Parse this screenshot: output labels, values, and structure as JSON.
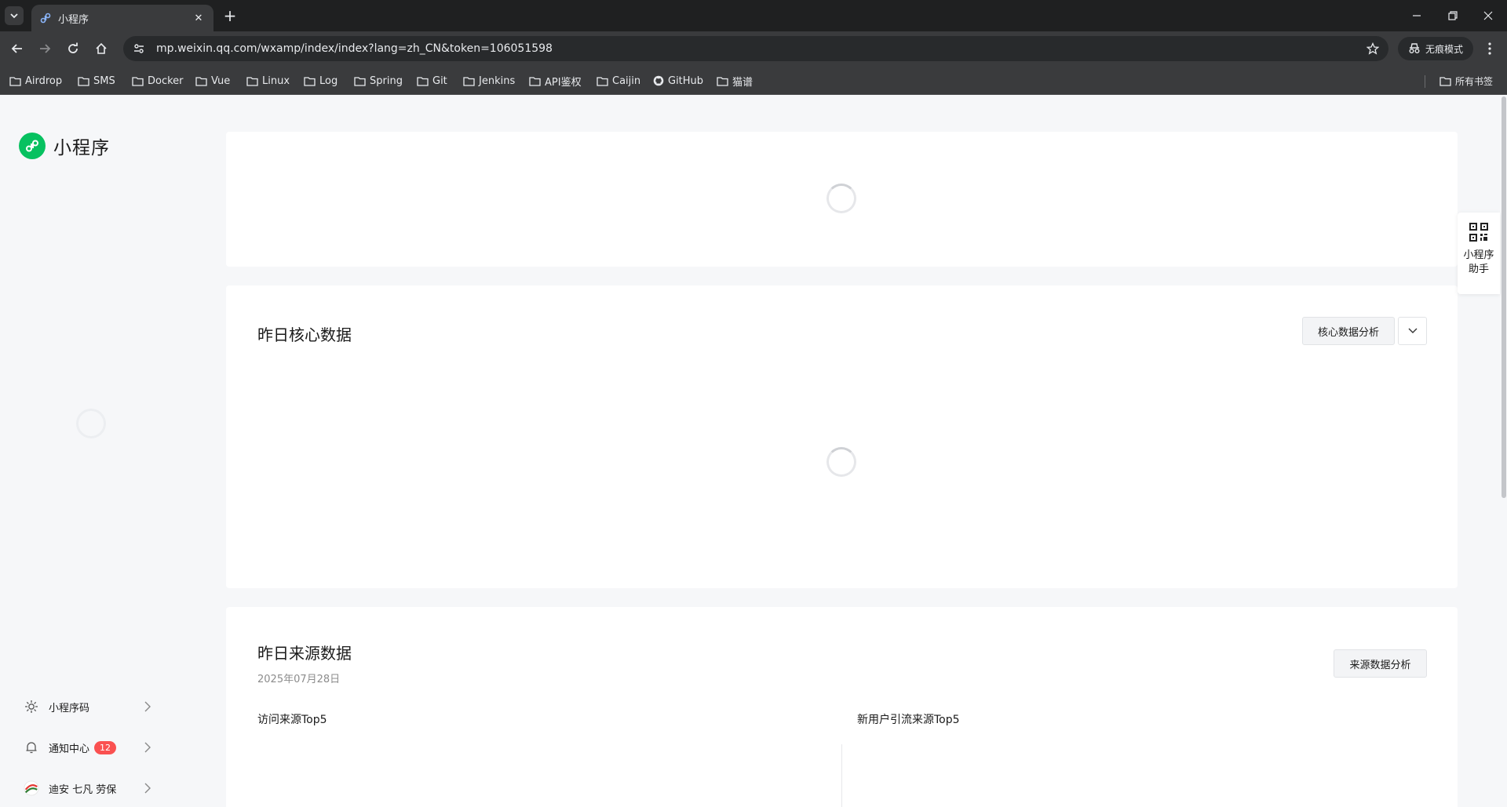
{
  "browser": {
    "tab_title": "小程序",
    "url": "mp.weixin.qq.com/wxamp/index/index?lang=zh_CN&token=106051598",
    "incognito_label": "无痕模式",
    "bookmarks": [
      "Airdrop",
      "SMS",
      "Docker",
      "Vue",
      "Linux",
      "Log",
      "Spring",
      "Git",
      "Jenkins",
      "API鉴权",
      "Caijin",
      "GitHub",
      "猫谱"
    ],
    "all_bookmarks_label": "所有书签"
  },
  "sidebar": {
    "logo_text": "小程序",
    "items": [
      {
        "label": "小程序码",
        "icon": "sun-icon"
      },
      {
        "label": "通知中心",
        "icon": "bell-icon",
        "badge": "12"
      },
      {
        "label": "迪安 七凡 劳保",
        "icon": "app-avatar-icon"
      }
    ]
  },
  "main": {
    "core_card": {
      "title": "昨日核心数据",
      "analysis_button": "核心数据分析"
    },
    "source_card": {
      "title": "昨日来源数据",
      "date": "2025年07月28日",
      "analysis_button": "来源数据分析",
      "col_left_title": "访问来源Top5",
      "col_right_title": "新用户引流来源Top5"
    }
  },
  "floating_helper": {
    "label_line1": "小程序",
    "label_line2": "助手"
  },
  "colors": {
    "brand_green": "#07c160",
    "badge_red": "#fa5151"
  }
}
